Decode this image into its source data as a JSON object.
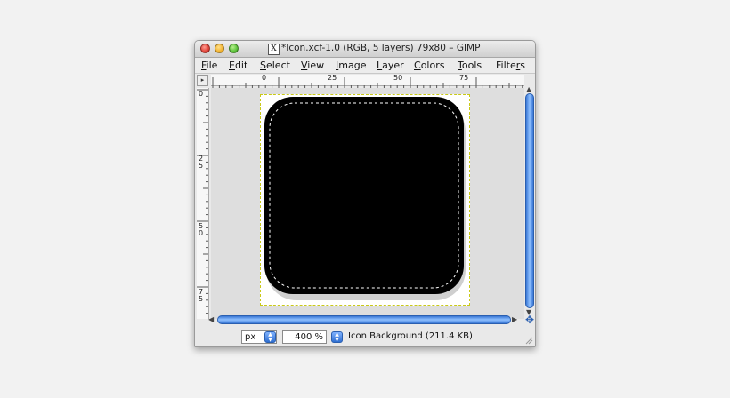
{
  "window": {
    "title": "*Icon.xcf-1.0 (RGB, 5 layers) 79x80 – GIMP",
    "x11_glyph": "X"
  },
  "menu": [
    {
      "label": "File",
      "key": "F"
    },
    {
      "label": "Edit",
      "key": "E"
    },
    {
      "label": "Select",
      "key": "S"
    },
    {
      "label": "View",
      "key": "V"
    },
    {
      "label": "Image",
      "key": "I"
    },
    {
      "label": "Layer",
      "key": "L"
    },
    {
      "label": "Colors",
      "key": "C"
    },
    {
      "label": "Tools",
      "key": "T"
    },
    {
      "label": "Filters",
      "key": "r"
    }
  ],
  "rulers": {
    "horizontal_labels": [
      "0",
      "25",
      "50",
      "75"
    ],
    "vertical_labels": [
      "0",
      "25",
      "50",
      "75"
    ],
    "corner_glyph": "▸"
  },
  "statusbar": {
    "unit": "px",
    "zoom": "400 %",
    "layer_info": "Icon Background (211.4 KB)"
  },
  "colors": {
    "scroll_blue": "#3a78d6",
    "selection_dashes": "#c9c917",
    "image_fill": "#000000"
  }
}
